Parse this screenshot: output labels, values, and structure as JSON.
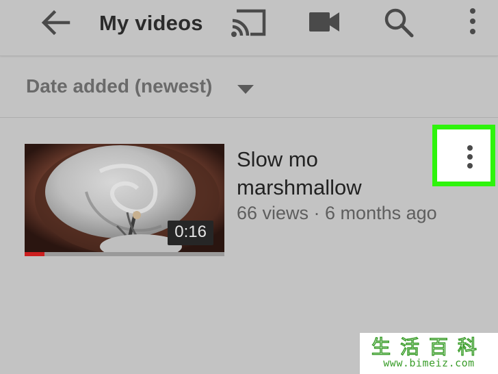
{
  "header": {
    "title": "My videos",
    "icons": [
      "back-arrow-icon",
      "cast-icon",
      "camera-icon",
      "search-icon",
      "more-vert-icon"
    ]
  },
  "sort": {
    "label": "Date added (newest)",
    "icon": "caret-down-icon"
  },
  "video": {
    "title": "Slow mo marshmallow",
    "meta": "66 views · 6 months ago",
    "duration": "0:16",
    "progress": 0.1,
    "menu_icon": "more-vert-icon"
  },
  "highlight_color": "#2ef40c",
  "watermark": {
    "logo_text": "生活百科",
    "url": "www.bimeiz.com"
  },
  "colors": {
    "background": "#c3c3c3",
    "progress": "#cc1f1f",
    "watermark": "#3a9d2a"
  }
}
